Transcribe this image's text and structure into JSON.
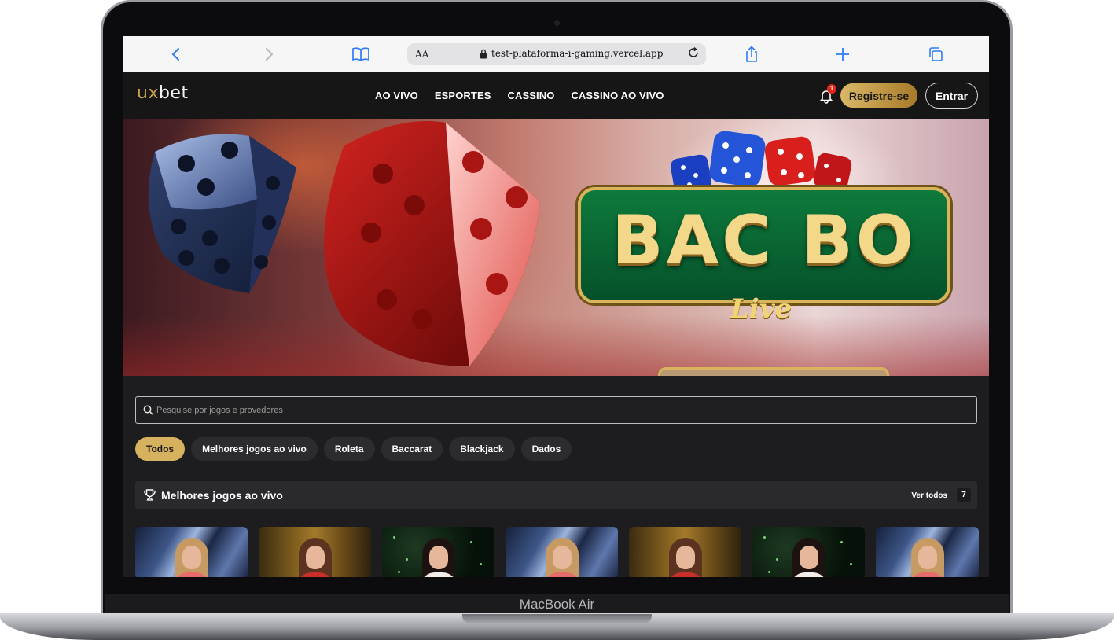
{
  "device": {
    "label": "MacBook Air"
  },
  "browser": {
    "text_size_label": "AA",
    "url": "test-plataforma-i-gaming.vercel.app"
  },
  "header": {
    "logo": {
      "ux": "ux",
      "bet": "bet"
    },
    "nav": [
      "AO VIVO",
      "ESPORTES",
      "CASSINO",
      "CASSINO AO VIVO"
    ],
    "notification_count": "1",
    "register_label": "Registre-se",
    "login_label": "Entrar"
  },
  "banner": {
    "title": "BAC BO",
    "subtitle": "Live"
  },
  "search": {
    "placeholder": "Pesquise por jogos e provedores"
  },
  "filters": {
    "chips": [
      "Todos",
      "Melhores jogos ao vivo",
      "Roleta",
      "Baccarat",
      "Blackjack",
      "Dados"
    ],
    "active": "Todos"
  },
  "section": {
    "title": "Melhores jogos ao vivo",
    "see_all_label": "Ver todos",
    "count": "7"
  },
  "colors": {
    "accent_gold": "#d6b15e",
    "header_bg": "#161617",
    "page_bg": "#1d1d1f",
    "badge_red": "#e0261c",
    "browser_blue": "#2f7cf6"
  },
  "icons": {
    "back": "chevron-left-icon",
    "forward": "chevron-right-icon",
    "bookmarks": "book-icon",
    "lock": "lock-icon",
    "reload": "reload-icon",
    "share": "share-icon",
    "new_tab": "plus-icon",
    "tabs": "tabs-icon",
    "bell": "bell-icon",
    "search": "search-icon",
    "trophy": "trophy-icon"
  }
}
